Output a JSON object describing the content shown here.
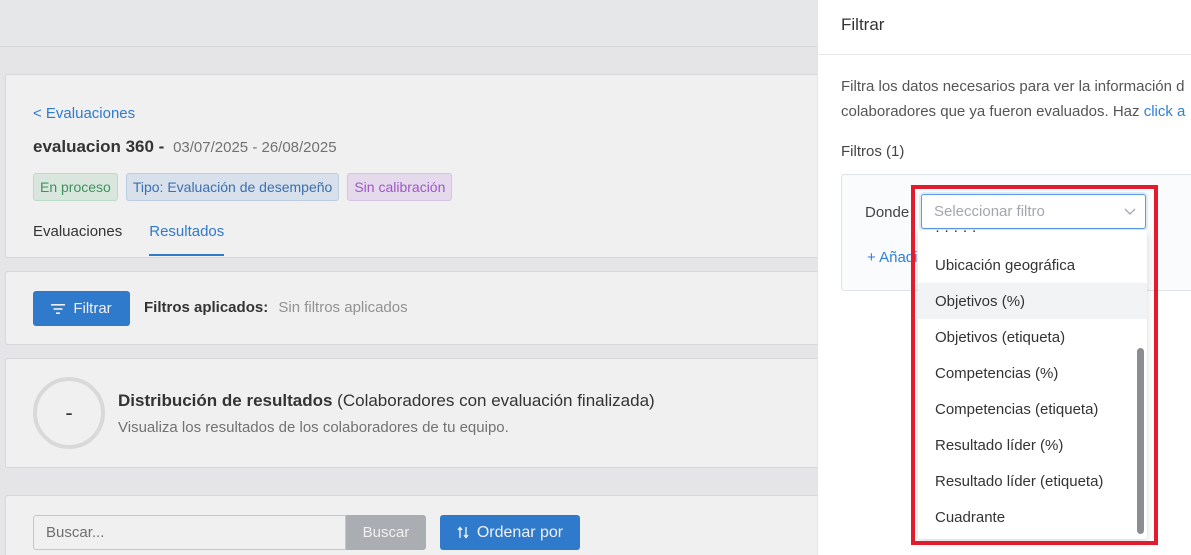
{
  "back_link": "< Evaluaciones",
  "evaluation": {
    "title": "evaluacion 360 -",
    "dates": "03/07/2025 - 26/08/2025",
    "badges": {
      "status": "En proceso",
      "type": "Tipo: Evaluación de desempeño",
      "calibration": "Sin calibración"
    }
  },
  "tabs": {
    "evaluations": "Evaluaciones",
    "results": "Resultados"
  },
  "filter_bar": {
    "filter_button": "Filtrar",
    "applied_label": "Filtros aplicados:",
    "applied_value": "Sin filtros aplicados"
  },
  "distribution": {
    "ring_value": "-",
    "title": "Distribución de resultados",
    "title_suffix": "(Colaboradores con evaluación finalizada)",
    "subtitle": "Visualiza los resultados de los colaboradores de tu equipo."
  },
  "search": {
    "placeholder": "Buscar...",
    "button": "Buscar",
    "order_button": "Ordenar por"
  },
  "drawer": {
    "title": "Filtrar",
    "desc_line1": "Filtra los datos necesarios para ver la información d",
    "desc_line2": "colaboradores que ya fueron evaluados. Haz ",
    "desc_link": "click a",
    "filters_count": "Filtros (1)",
    "where_label": "Donde",
    "add_link": "+ Añadi",
    "select_placeholder": "Seleccionar filtro",
    "menu_partial": "· · · · ·",
    "options": {
      "o1": "Ubicación geográfica",
      "o2": "Objetivos (%)",
      "o3": "Objetivos (etiqueta)",
      "o4": "Competencias (%)",
      "o5": "Competencias (etiqueta)",
      "o6": "Resultado líder (%)",
      "o7": "Resultado líder (etiqueta)",
      "o8": "Cuadrante"
    }
  },
  "icons": {
    "filter": "filter-lines-icon",
    "sort": "sort-arrows-icon",
    "chevron": "chevron-down-icon"
  },
  "colors": {
    "primary": "#2f7fd8",
    "highlight": "#e31c2d"
  }
}
